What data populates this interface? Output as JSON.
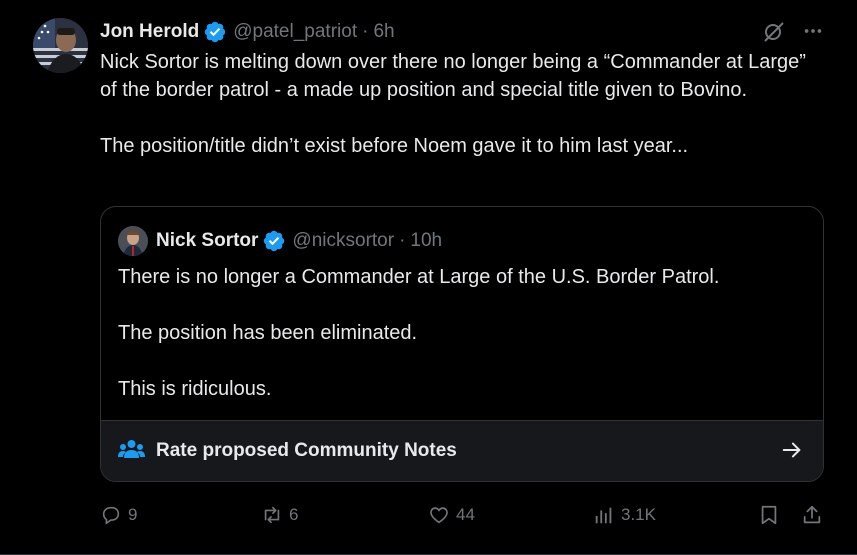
{
  "tweet": {
    "author_name": "Jon Herold",
    "handle": "@patel_patriot",
    "time": "6h",
    "paragraphs": [
      "Nick Sortor is melting down over there no longer being a “Commander at Large” of the border patrol - a made up position and special title given to Bovino.",
      "The position/title didn’t exist before Noem gave it to him last year..."
    ]
  },
  "quote": {
    "author_name": "Nick Sortor",
    "handle": "@nicksortor",
    "time": "10h",
    "paragraphs": [
      "There is no longer a Commander at Large of the U.S. Border Patrol.",
      "The position has been eliminated.",
      "This is ridiculous."
    ],
    "community_notes_label": "Rate proposed Community Notes"
  },
  "actions": {
    "replies": "9",
    "reposts": "6",
    "likes": "44",
    "views": "3.1K"
  },
  "colors": {
    "background": "#000000",
    "text": "#e7e9ea",
    "muted": "#71767b",
    "verified": "#1d9bf0",
    "border": "#2f3336"
  },
  "icons": [
    "verified-badge-icon",
    "grok-icon",
    "more-icon",
    "community-notes-icon",
    "arrow-right-icon",
    "reply-icon",
    "repost-icon",
    "like-icon",
    "views-icon",
    "bookmark-icon",
    "share-icon"
  ]
}
